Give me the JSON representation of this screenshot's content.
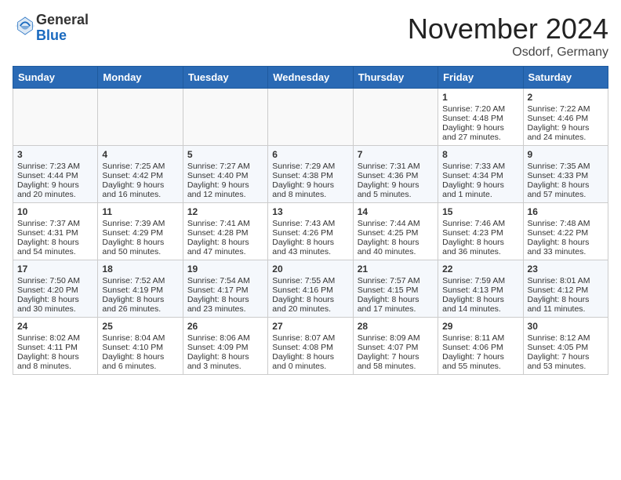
{
  "header": {
    "logo_general": "General",
    "logo_blue": "Blue",
    "month_title": "November 2024",
    "location": "Osdorf, Germany"
  },
  "days_of_week": [
    "Sunday",
    "Monday",
    "Tuesday",
    "Wednesday",
    "Thursday",
    "Friday",
    "Saturday"
  ],
  "weeks": [
    [
      {
        "day": "",
        "content": ""
      },
      {
        "day": "",
        "content": ""
      },
      {
        "day": "",
        "content": ""
      },
      {
        "day": "",
        "content": ""
      },
      {
        "day": "",
        "content": ""
      },
      {
        "day": "1",
        "content": "Sunrise: 7:20 AM\nSunset: 4:48 PM\nDaylight: 9 hours and 27 minutes."
      },
      {
        "day": "2",
        "content": "Sunrise: 7:22 AM\nSunset: 4:46 PM\nDaylight: 9 hours and 24 minutes."
      }
    ],
    [
      {
        "day": "3",
        "content": "Sunrise: 7:23 AM\nSunset: 4:44 PM\nDaylight: 9 hours and 20 minutes."
      },
      {
        "day": "4",
        "content": "Sunrise: 7:25 AM\nSunset: 4:42 PM\nDaylight: 9 hours and 16 minutes."
      },
      {
        "day": "5",
        "content": "Sunrise: 7:27 AM\nSunset: 4:40 PM\nDaylight: 9 hours and 12 minutes."
      },
      {
        "day": "6",
        "content": "Sunrise: 7:29 AM\nSunset: 4:38 PM\nDaylight: 9 hours and 8 minutes."
      },
      {
        "day": "7",
        "content": "Sunrise: 7:31 AM\nSunset: 4:36 PM\nDaylight: 9 hours and 5 minutes."
      },
      {
        "day": "8",
        "content": "Sunrise: 7:33 AM\nSunset: 4:34 PM\nDaylight: 9 hours and 1 minute."
      },
      {
        "day": "9",
        "content": "Sunrise: 7:35 AM\nSunset: 4:33 PM\nDaylight: 8 hours and 57 minutes."
      }
    ],
    [
      {
        "day": "10",
        "content": "Sunrise: 7:37 AM\nSunset: 4:31 PM\nDaylight: 8 hours and 54 minutes."
      },
      {
        "day": "11",
        "content": "Sunrise: 7:39 AM\nSunset: 4:29 PM\nDaylight: 8 hours and 50 minutes."
      },
      {
        "day": "12",
        "content": "Sunrise: 7:41 AM\nSunset: 4:28 PM\nDaylight: 8 hours and 47 minutes."
      },
      {
        "day": "13",
        "content": "Sunrise: 7:43 AM\nSunset: 4:26 PM\nDaylight: 8 hours and 43 minutes."
      },
      {
        "day": "14",
        "content": "Sunrise: 7:44 AM\nSunset: 4:25 PM\nDaylight: 8 hours and 40 minutes."
      },
      {
        "day": "15",
        "content": "Sunrise: 7:46 AM\nSunset: 4:23 PM\nDaylight: 8 hours and 36 minutes."
      },
      {
        "day": "16",
        "content": "Sunrise: 7:48 AM\nSunset: 4:22 PM\nDaylight: 8 hours and 33 minutes."
      }
    ],
    [
      {
        "day": "17",
        "content": "Sunrise: 7:50 AM\nSunset: 4:20 PM\nDaylight: 8 hours and 30 minutes."
      },
      {
        "day": "18",
        "content": "Sunrise: 7:52 AM\nSunset: 4:19 PM\nDaylight: 8 hours and 26 minutes."
      },
      {
        "day": "19",
        "content": "Sunrise: 7:54 AM\nSunset: 4:17 PM\nDaylight: 8 hours and 23 minutes."
      },
      {
        "day": "20",
        "content": "Sunrise: 7:55 AM\nSunset: 4:16 PM\nDaylight: 8 hours and 20 minutes."
      },
      {
        "day": "21",
        "content": "Sunrise: 7:57 AM\nSunset: 4:15 PM\nDaylight: 8 hours and 17 minutes."
      },
      {
        "day": "22",
        "content": "Sunrise: 7:59 AM\nSunset: 4:13 PM\nDaylight: 8 hours and 14 minutes."
      },
      {
        "day": "23",
        "content": "Sunrise: 8:01 AM\nSunset: 4:12 PM\nDaylight: 8 hours and 11 minutes."
      }
    ],
    [
      {
        "day": "24",
        "content": "Sunrise: 8:02 AM\nSunset: 4:11 PM\nDaylight: 8 hours and 8 minutes."
      },
      {
        "day": "25",
        "content": "Sunrise: 8:04 AM\nSunset: 4:10 PM\nDaylight: 8 hours and 6 minutes."
      },
      {
        "day": "26",
        "content": "Sunrise: 8:06 AM\nSunset: 4:09 PM\nDaylight: 8 hours and 3 minutes."
      },
      {
        "day": "27",
        "content": "Sunrise: 8:07 AM\nSunset: 4:08 PM\nDaylight: 8 hours and 0 minutes."
      },
      {
        "day": "28",
        "content": "Sunrise: 8:09 AM\nSunset: 4:07 PM\nDaylight: 7 hours and 58 minutes."
      },
      {
        "day": "29",
        "content": "Sunrise: 8:11 AM\nSunset: 4:06 PM\nDaylight: 7 hours and 55 minutes."
      },
      {
        "day": "30",
        "content": "Sunrise: 8:12 AM\nSunset: 4:05 PM\nDaylight: 7 hours and 53 minutes."
      }
    ]
  ]
}
